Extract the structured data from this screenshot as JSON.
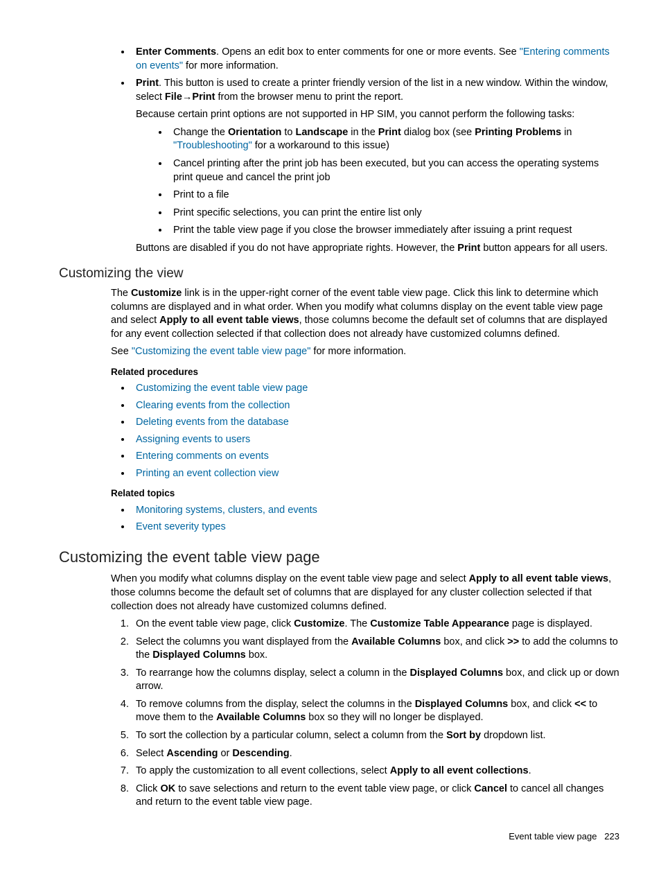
{
  "bullets": {
    "enterComments": {
      "label": "Enter Comments",
      "text": ". Opens an edit box to enter comments for one or more events. See ",
      "link": "\"Entering comments on events\"",
      "text2": " for more information."
    },
    "print": {
      "label": "Print",
      "intro1": ". This button is used to create a printer friendly version of the list in a new window. Within the window, select ",
      "file": "File",
      "arrow": "→",
      "printB": "Print",
      "intro2": " from the browser menu to print the report.",
      "because": "Because certain print options are not supported in HP SIM, you cannot perform the following tasks:",
      "sub": {
        "orientation1": "Change the ",
        "orientationB": "Orientation",
        "orientation2": " to ",
        "landscapeB": "Landscape",
        "orientation3": " in the ",
        "printDlgB": "Print",
        "orientation4": " dialog box (see ",
        "printingProbB": "Printing Problems",
        "orientation5": " in ",
        "troubleLink": "\"Troubleshooting\"",
        "orientation6": " for a workaround to this issue)",
        "cancel": "Cancel printing after the print job has been executed, but you can access the operating systems print queue and cancel the print job",
        "toFile": "Print to a file",
        "specific": "Print specific selections, you can print the entire list only",
        "closeBrowser": "Print the table view page if you close the browser immediately after issuing a print request"
      },
      "buttonsDisabled1": "Buttons are disabled if you do not have appropriate rights. However, the ",
      "buttonsDisabled2": " button appears for all users."
    }
  },
  "custView": {
    "heading": "Customizing the view",
    "para1a": "The ",
    "customizeB": "Customize",
    "para1b": " link is in the upper-right corner of the event table view page. Click this link to determine which columns are displayed and in what order. When you modify what columns display on the event table view page and select ",
    "applyB": "Apply to all event table views",
    "para1c": ", those columns become the default set of columns that are displayed for any event collection selected if that collection does not already have customized columns defined.",
    "see1": "See ",
    "seeLink": "\"Customizing the event table view page\"",
    "see2": " for more information."
  },
  "relatedProcHead": "Related procedures",
  "relatedProc": [
    "Customizing the event table view page",
    "Clearing events from the collection",
    "Deleting events from the database",
    "Assigning events to users",
    "Entering comments on events",
    "Printing an event collection view"
  ],
  "relatedTopicsHead": "Related topics",
  "relatedTopics": [
    "Monitoring systems, clusters, and events",
    "Event severity types"
  ],
  "custPage": {
    "heading": "Customizing the event table view page",
    "intro1": "When you modify what columns display on the event table view page and select ",
    "applyB": "Apply to all event table views",
    "intro2": ", those columns become the default set of columns that are displayed for any cluster collection selected if that collection does not already have customized columns defined.",
    "steps": {
      "s1a": "On the event table view page, click ",
      "s1CustomizeB": "Customize",
      "s1b": ". The ",
      "s1CustTabApp": "Customize Table Appearance",
      "s1c": " page is displayed.",
      "s2a": "Select the columns you want displayed from the ",
      "s2AvailB": "Available Columns",
      "s2b": " box, and click ",
      "s2ArrowB": ">>",
      "s2c": " to add the columns to the ",
      "s2DispB": "Displayed Columns",
      "s2d": " box.",
      "s3a": "To rearrange how the columns display, select a column in the ",
      "s3DispB": "Displayed Columns",
      "s3b": " box, and click up or down arrow.",
      "s4a": "To remove columns from the display, select the columns in the ",
      "s4DispB": "Displayed Columns",
      "s4b": " box, and click ",
      "s4ArrowB": "<<",
      "s4c": " to move them to the ",
      "s4AvailB": "Available Columns",
      "s4d": " box so they will no longer be displayed.",
      "s5a": "To sort the collection by a particular column, select a column from the ",
      "s5SortByB": "Sort by",
      "s5b": " dropdown list.",
      "s6a": "Select ",
      "s6AscB": "Ascending",
      "s6or": " or ",
      "s6DescB": "Descending",
      "s6b": ".",
      "s7a": "To apply the customization to all event collections, select ",
      "s7ApplyB": "Apply to all event collections",
      "s7b": ".",
      "s8a": "Click ",
      "s8OkB": "OK",
      "s8b": " to save selections and return to the event table view page, or click ",
      "s8CancelB": "Cancel",
      "s8c": " to cancel all changes and return to the event table view page."
    }
  },
  "footer": {
    "title": "Event table view page",
    "page": "223"
  }
}
